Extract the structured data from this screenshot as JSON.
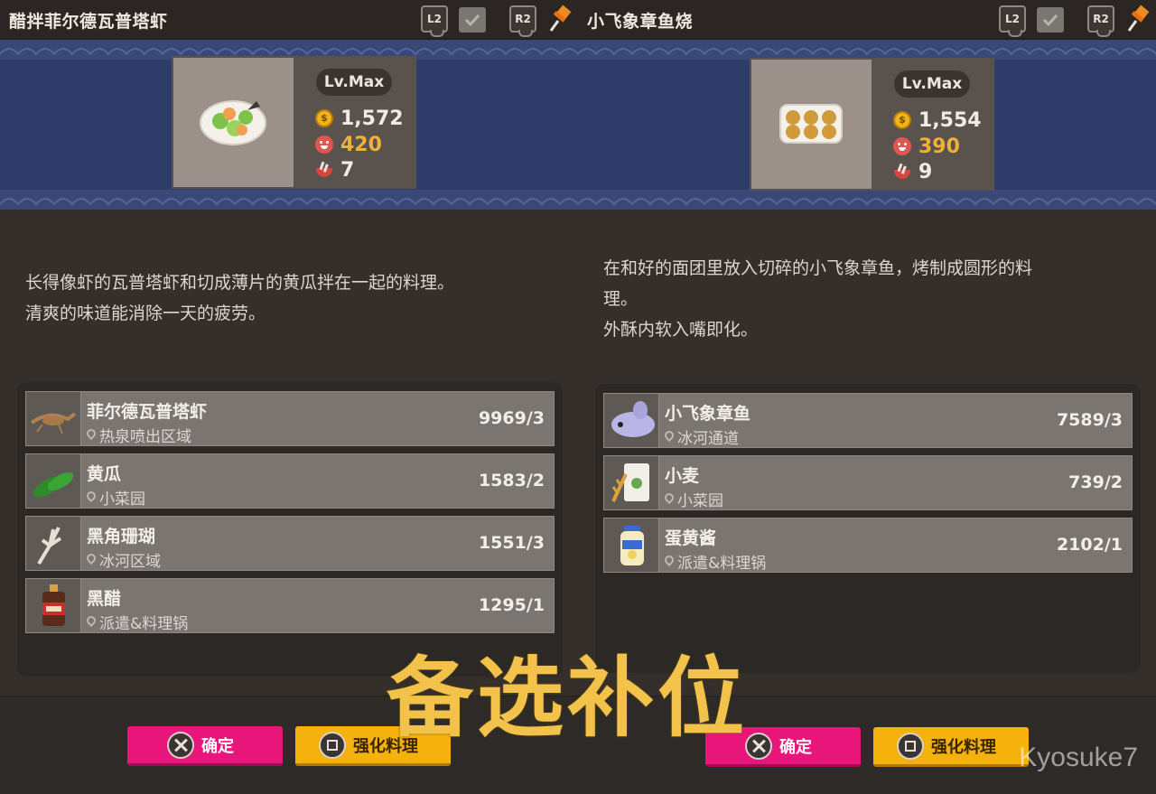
{
  "panels": [
    {
      "title": "醋拌菲尔德瓦普塔虾",
      "l2_label": "L2",
      "r2_label": "R2",
      "level": "Lv.Max",
      "price": "1,572",
      "happiness": "420",
      "servings": "7",
      "description": [
        "长得像虾的瓦普塔虾和切成薄片的黄瓜拌在一起的料理。",
        "清爽的味道能消除一天的疲劳。"
      ],
      "ingredients": [
        {
          "name": "菲尔德瓦普塔虾",
          "location": "热泉喷出区域",
          "count": "9969/3",
          "icon": "shrimp-icon"
        },
        {
          "name": "黄瓜",
          "location": "小菜园",
          "count": "1583/2",
          "icon": "cucumber-icon"
        },
        {
          "name": "黑角珊瑚",
          "location": "冰河区域",
          "count": "1551/3",
          "icon": "coral-icon"
        },
        {
          "name": "黑醋",
          "location": "派遣&料理锅",
          "count": "1295/1",
          "icon": "vinegar-bottle-icon"
        }
      ],
      "confirm_label": "确定",
      "enhance_label": "强化料理"
    },
    {
      "title": "小飞象章鱼烧",
      "l2_label": "L2",
      "r2_label": "R2",
      "level": "Lv.Max",
      "price": "1,554",
      "happiness": "390",
      "servings": "9",
      "description": [
        "在和好的面团里放入切碎的小飞象章鱼，烤制成圆形的料",
        "理。",
        "外酥内软入嘴即化。"
      ],
      "ingredients": [
        {
          "name": "小飞象章鱼",
          "location": "冰河通道",
          "count": "7589/3",
          "icon": "dumbo-octopus-icon"
        },
        {
          "name": "小麦",
          "location": "小菜园",
          "count": "739/2",
          "icon": "wheat-flour-icon"
        },
        {
          "name": "蛋黄酱",
          "location": "派遣&料理锅",
          "count": "2102/1",
          "icon": "mayonnaise-icon"
        }
      ],
      "confirm_label": "确定",
      "enhance_label": "强化料理"
    }
  ],
  "overlay_text": "备选补位",
  "watermark": "Kyosuke7",
  "colors": {
    "confirm": "#e8167a",
    "enhance": "#f5b10c",
    "banner": "#2f3c69",
    "gold": "#f0b13a"
  }
}
